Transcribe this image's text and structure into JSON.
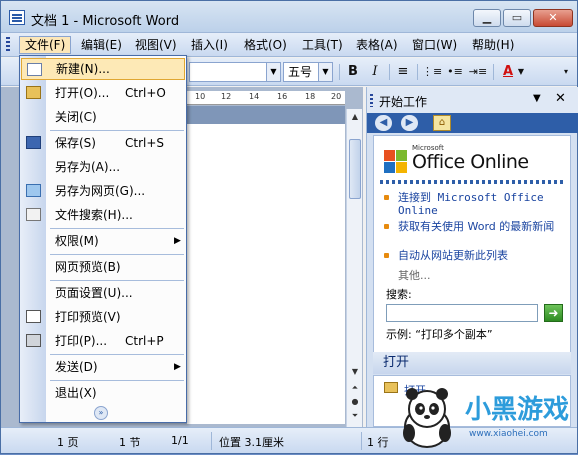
{
  "window": {
    "title": "文档 1 - Microsoft Word"
  },
  "menubar": {
    "items": [
      {
        "label": "文件(F)"
      },
      {
        "label": "编辑(E)"
      },
      {
        "label": "视图(V)"
      },
      {
        "label": "插入(I)"
      },
      {
        "label": "格式(O)"
      },
      {
        "label": "工具(T)"
      },
      {
        "label": "表格(A)"
      },
      {
        "label": "窗口(W)"
      },
      {
        "label": "帮助(H)"
      }
    ]
  },
  "toolbar": {
    "font_size": "五号"
  },
  "ruler": {
    "ticks": [
      "10",
      "12",
      "14",
      "16",
      "18",
      "20"
    ]
  },
  "file_menu": {
    "items": [
      {
        "label": "新建(N)...",
        "shortcut": ""
      },
      {
        "label": "打开(O)...",
        "shortcut": "Ctrl+O"
      },
      {
        "label": "关闭(C)",
        "shortcut": ""
      },
      {
        "label": "保存(S)",
        "shortcut": "Ctrl+S"
      },
      {
        "label": "另存为(A)...",
        "shortcut": ""
      },
      {
        "label": "另存为网页(G)...",
        "shortcut": ""
      },
      {
        "label": "文件搜索(H)...",
        "shortcut": ""
      },
      {
        "label": "权限(M)",
        "shortcut": ""
      },
      {
        "label": "网页预览(B)",
        "shortcut": ""
      },
      {
        "label": "页面设置(U)...",
        "shortcut": ""
      },
      {
        "label": "打印预览(V)",
        "shortcut": ""
      },
      {
        "label": "打印(P)...",
        "shortcut": "Ctrl+P"
      },
      {
        "label": "发送(D)",
        "shortcut": ""
      },
      {
        "label": "退出(X)",
        "shortcut": ""
      }
    ]
  },
  "task_pane": {
    "title": "开始工作",
    "office_online": {
      "small": "Microsoft",
      "brand": "Office Online"
    },
    "links": [
      "连接到 Microsoft Office Online",
      "获取有关使用 Word 的最新新闻",
      "自动从网站更新此列表"
    ],
    "more": "其他...",
    "search_label": "搜索:",
    "search_value": "",
    "example": "示例: “打印多个副本”",
    "open_header": "打开",
    "open_item": "打开..."
  },
  "status_bar": {
    "page": "1 页",
    "section": "1 节",
    "page_of": "1/1",
    "position": "位置 3.1厘米",
    "line": "1 行"
  },
  "watermark": {
    "title": "小黑游戏",
    "url": "www.xiaohei.com"
  },
  "colors": {
    "accent": "#2e5ea8",
    "menu_highlight": "#fde9b6",
    "bullet": "#e78a0e"
  }
}
